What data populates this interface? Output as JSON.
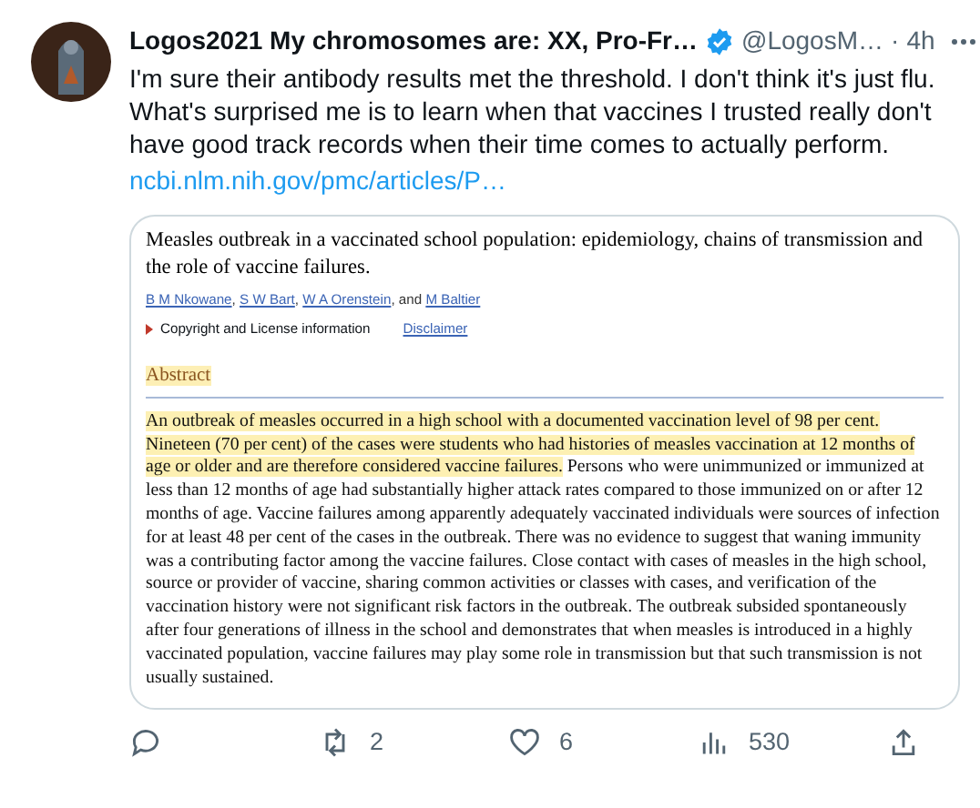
{
  "tweet": {
    "display_name": "Logos2021 My chromosomes are: XX, Pro-Fr…",
    "verified": true,
    "handle": "@LogosM…",
    "separator": "·",
    "time": "4h",
    "text": "I'm sure their antibody results met the threshold. I don't think it's just flu. What's surprised me is to learn when that vaccines I trusted really don't have good track records when their time comes to actually perform.",
    "link": "ncbi.nlm.nih.gov/pmc/articles/P…"
  },
  "article": {
    "title": "Measles outbreak in a vaccinated school population: epidemiology, chains of transmission and the role of vaccine failures.",
    "authors": [
      {
        "kind": "link",
        "text": "B M Nkowane"
      },
      {
        "kind": "plain",
        "text": ", "
      },
      {
        "kind": "link",
        "text": "S W Bart"
      },
      {
        "kind": "plain",
        "text": ", "
      },
      {
        "kind": "link",
        "text": "W A Orenstein"
      },
      {
        "kind": "plain",
        "text": ", and "
      },
      {
        "kind": "link",
        "text": "M Baltier"
      }
    ],
    "copyright": "Copyright and License information",
    "disclaimer": "Disclaimer",
    "abstract_heading": "Abstract",
    "abstract_highlighted": "An outbreak of measles occurred in a high school with a documented vaccination level of 98 per cent. Nineteen (70 per cent) of the cases were students who had histories of measles vaccination at 12 months of age or older and are therefore considered vaccine failures.",
    "abstract_rest": " Persons who were unimmunized or immunized at less than 12 months of age had substantially higher attack rates compared to those immunized on or after 12 months of age. Vaccine failures among apparently adequately vaccinated individuals were sources of infection for at least 48 per cent of the cases in the outbreak. There was no evidence to suggest that waning immunity was a contributing factor among the vaccine failures. Close contact with cases of measles in the high school, source or provider of vaccine, sharing common activities or classes with cases, and verification of the vaccination history were not significant risk factors in the outbreak. The outbreak subsided spontaneously after four generations of illness in the school and demonstrates that when measles is introduced in a highly vaccinated population, vaccine failures may play some role in transmission but that such transmission is not usually sustained."
  },
  "actions": [
    {
      "kind": "reply"
    },
    {
      "kind": "retweet",
      "count": "2"
    },
    {
      "kind": "like",
      "count": "6"
    },
    {
      "kind": "views",
      "count": "530"
    },
    {
      "kind": "share"
    }
  ]
}
